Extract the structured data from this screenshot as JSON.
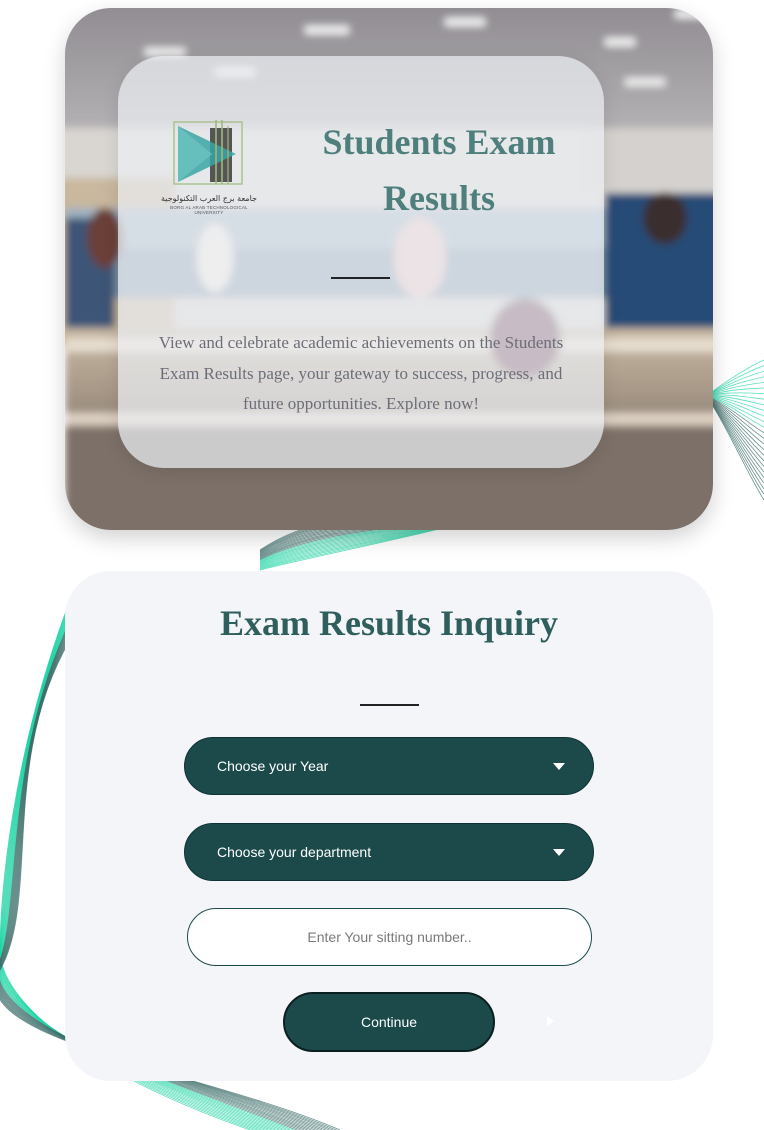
{
  "hero": {
    "title": "Students Exam Results",
    "description": "View and celebrate academic achievements on the Students Exam Results page, your gateway to success, progress, and future opportunities. Explore now!",
    "logo": {
      "name_ar": "جامعة برج العرب التكنولوجية",
      "name_en": "BORG AL ARAB TECHNOLOGICAL UNIVERSITY"
    }
  },
  "form": {
    "title": "Exam Results Inquiry",
    "year_select": {
      "label": "Choose your Year",
      "icon": "chevron-down-icon"
    },
    "department_select": {
      "label": "Choose your department",
      "icon": "chevron-down-icon"
    },
    "sitting_input": {
      "placeholder": "Enter Your sitting number..",
      "value": ""
    },
    "continue_label": "Continue"
  },
  "colors": {
    "primary": "#1c4a4b",
    "title": "#2f5f5c",
    "hero_title": "#4f7f7c",
    "card": "#f4f5f9",
    "line_accent": "#1fd4a4"
  }
}
